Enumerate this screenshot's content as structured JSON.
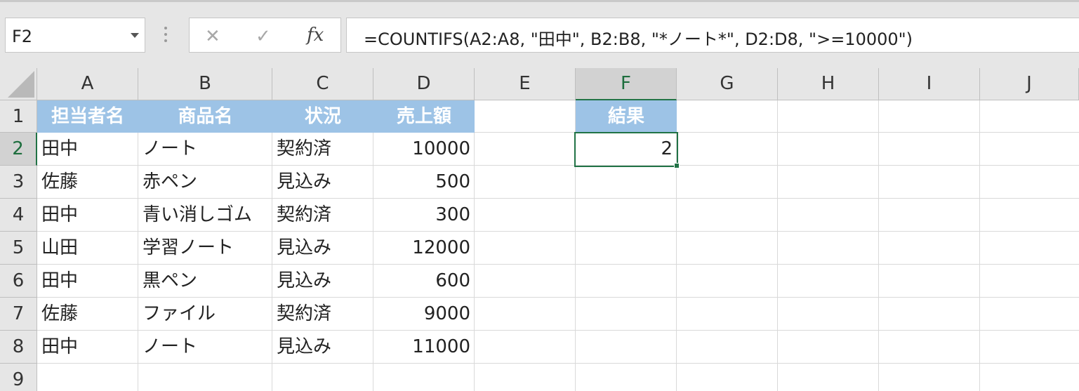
{
  "name_box": "F2",
  "formula_bar": {
    "cancel_icon": "✕",
    "enter_icon": "✓",
    "fx_label": "fx",
    "formula": "=COUNTIFS(A2:A8, \"田中\", B2:B8, \"*ノート*\", D2:D8, \">=10000\")"
  },
  "columns": [
    "A",
    "B",
    "C",
    "D",
    "E",
    "F",
    "G",
    "H",
    "I",
    "J"
  ],
  "rows": [
    "1",
    "2",
    "3",
    "4",
    "5",
    "6",
    "7",
    "8",
    "9"
  ],
  "table": {
    "headers": [
      "担当者名",
      "商品名",
      "状況",
      "売上額"
    ],
    "rows": [
      [
        "田中",
        "ノート",
        "契約済",
        "10000"
      ],
      [
        "佐藤",
        "赤ペン",
        "見込み",
        "500"
      ],
      [
        "田中",
        "青い消しゴム",
        "契約済",
        "300"
      ],
      [
        "山田",
        "学習ノート",
        "見込み",
        "12000"
      ],
      [
        "田中",
        "黒ペン",
        "見込み",
        "600"
      ],
      [
        "佐藤",
        "ファイル",
        "契約済",
        "9000"
      ],
      [
        "田中",
        "ノート",
        "見込み",
        "11000"
      ]
    ]
  },
  "result": {
    "header": "結果",
    "value": "2"
  },
  "colors": {
    "header_fill": "#9dc3e6",
    "selection": "#217346"
  }
}
